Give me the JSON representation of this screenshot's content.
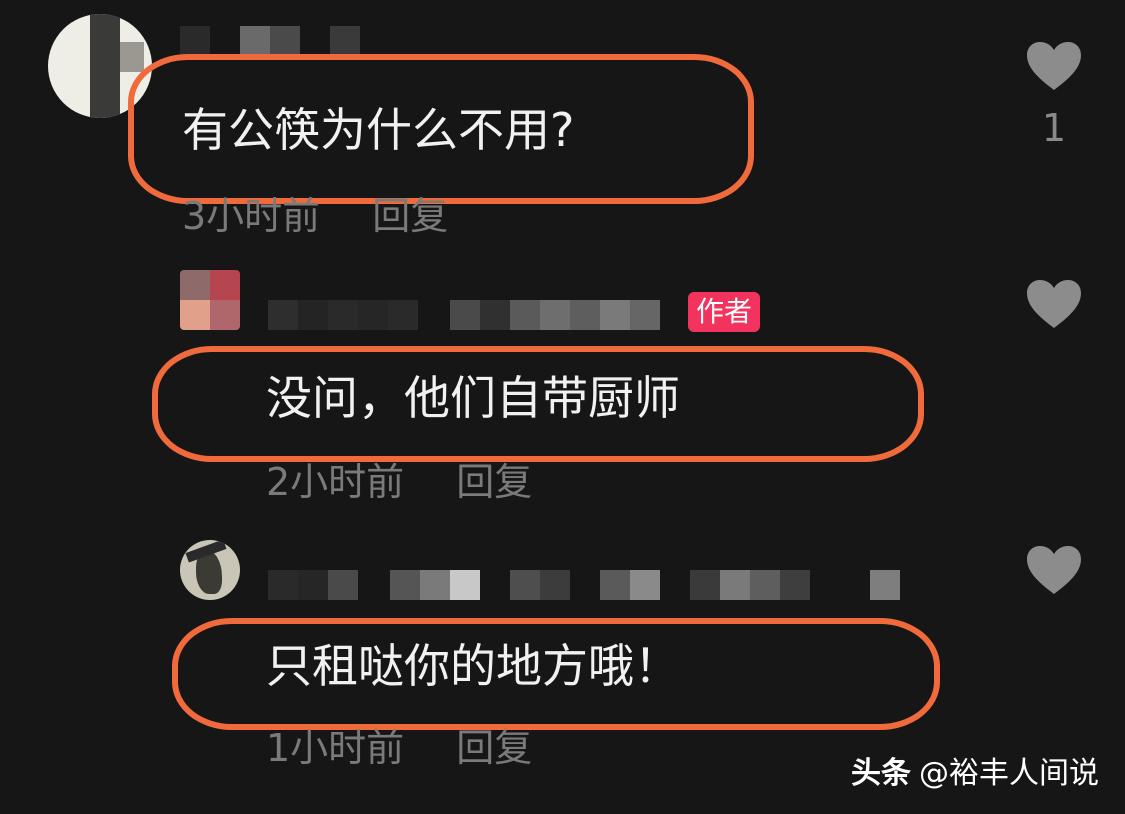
{
  "comments": [
    {
      "text": "有公筷为什么不用?",
      "time": "3小时前",
      "reply_label": "回复",
      "like_count": "1"
    },
    {
      "text": "没问，他们自带厨师",
      "time": "2小时前",
      "reply_label": "回复",
      "badge": "作者",
      "like_count": ""
    },
    {
      "text": "只租哒你的地方哦！",
      "time": "1小时前",
      "reply_label": "回复",
      "like_count": ""
    }
  ],
  "watermark": {
    "brand": "头条",
    "handle": "@裕丰人间说"
  },
  "colors": {
    "background": "#161616",
    "highlight_outline": "#f06a3b",
    "author_badge": "#f2335d",
    "like_icon": "#8c8c8c",
    "meta_text": "#7a7a7a"
  },
  "icons": {
    "like": "heart-icon"
  }
}
